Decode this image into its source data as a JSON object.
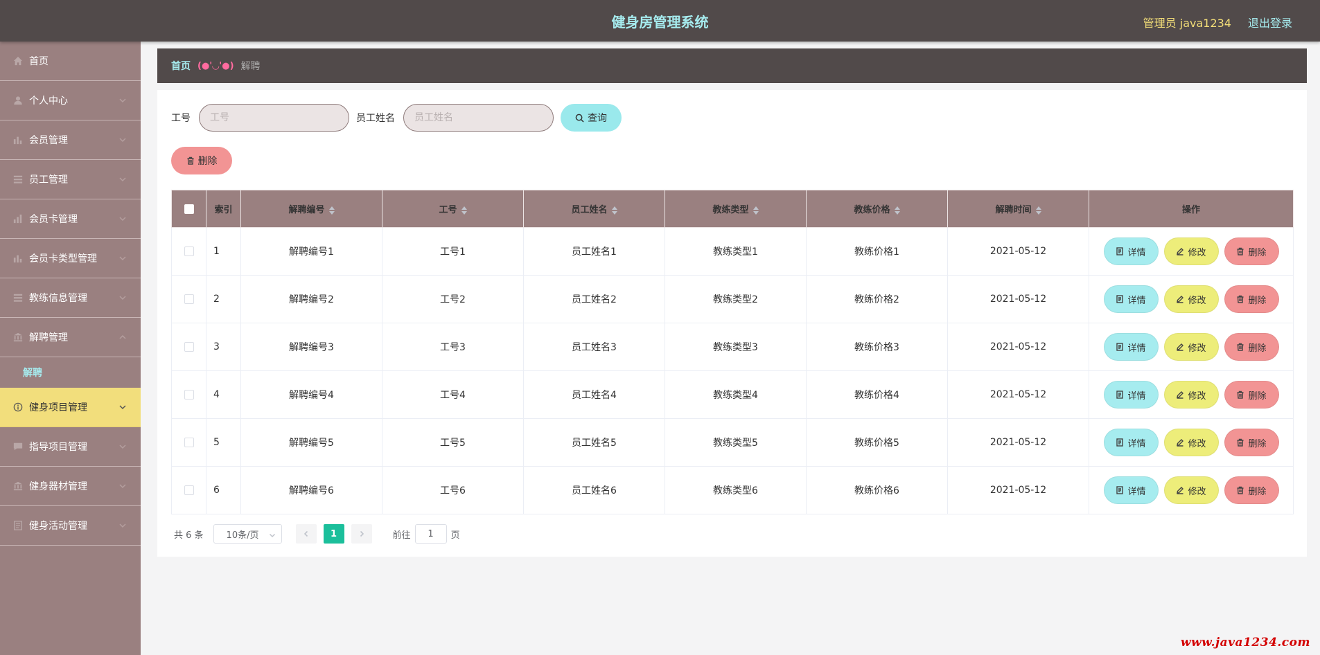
{
  "header": {
    "title": "健身房管理系统",
    "admin": "管理员 java1234",
    "logout": "退出登录"
  },
  "sidebar": {
    "items": [
      {
        "label": "首页",
        "icon": "home-icon"
      },
      {
        "label": "个人中心",
        "icon": "user-icon"
      },
      {
        "label": "会员管理",
        "icon": "chart-icon"
      },
      {
        "label": "员工管理",
        "icon": "list-icon"
      },
      {
        "label": "会员卡管理",
        "icon": "bar-chart-icon"
      },
      {
        "label": "会员卡类型管理",
        "icon": "chart-icon"
      },
      {
        "label": "教练信息管理",
        "icon": "list-icon"
      },
      {
        "label": "解聘管理",
        "icon": "bank-icon"
      },
      {
        "label": "健身项目管理",
        "icon": "info-circle-icon"
      },
      {
        "label": "指导项目管理",
        "icon": "message-icon"
      },
      {
        "label": "健身器材管理",
        "icon": "bank-icon"
      },
      {
        "label": "健身活动管理",
        "icon": "document-icon"
      }
    ],
    "submenu_label": "解聘"
  },
  "breadcrumb": {
    "home": "首页",
    "separator": "(●'◡'●)",
    "current": "解聘"
  },
  "search": {
    "field1_label": "工号",
    "field1_placeholder": "工号",
    "field2_label": "员工姓名",
    "field2_placeholder": "员工姓名",
    "query_label": "查询"
  },
  "toolbar": {
    "delete_label": "删除"
  },
  "table": {
    "columns": [
      "索引",
      "解聘编号",
      "工号",
      "员工姓名",
      "教练类型",
      "教练价格",
      "解聘时间",
      "操作"
    ],
    "rows": [
      [
        "1",
        "解聘编号1",
        "工号1",
        "员工姓名1",
        "教练类型1",
        "教练价格1",
        "2021-05-12"
      ],
      [
        "2",
        "解聘编号2",
        "工号2",
        "员工姓名2",
        "教练类型2",
        "教练价格2",
        "2021-05-12"
      ],
      [
        "3",
        "解聘编号3",
        "工号3",
        "员工姓名3",
        "教练类型3",
        "教练价格3",
        "2021-05-12"
      ],
      [
        "4",
        "解聘编号4",
        "工号4",
        "员工姓名4",
        "教练类型4",
        "教练价格4",
        "2021-05-12"
      ],
      [
        "5",
        "解聘编号5",
        "工号5",
        "员工姓名5",
        "教练类型5",
        "教练价格5",
        "2021-05-12"
      ],
      [
        "6",
        "解聘编号6",
        "工号6",
        "员工姓名6",
        "教练类型6",
        "教练价格6",
        "2021-05-12"
      ]
    ],
    "actions": {
      "detail": "详情",
      "edit": "修改",
      "delete": "删除"
    }
  },
  "pagination": {
    "total": "共 6 条",
    "page_size": "10条/页",
    "current_page": "1",
    "goto_label": "前往",
    "goto_value": "1",
    "page_suffix": "页"
  },
  "watermark": "www.java1234.com",
  "colors": {
    "topbar": "#514a4a",
    "sidebar": "#9a8080",
    "accent_cyan": "#a6ecef",
    "accent_yellow": "#f2de7c",
    "danger_pink": "#f29494",
    "edit_yellow": "#eded7a",
    "pager_active": "#1bbf9b"
  }
}
